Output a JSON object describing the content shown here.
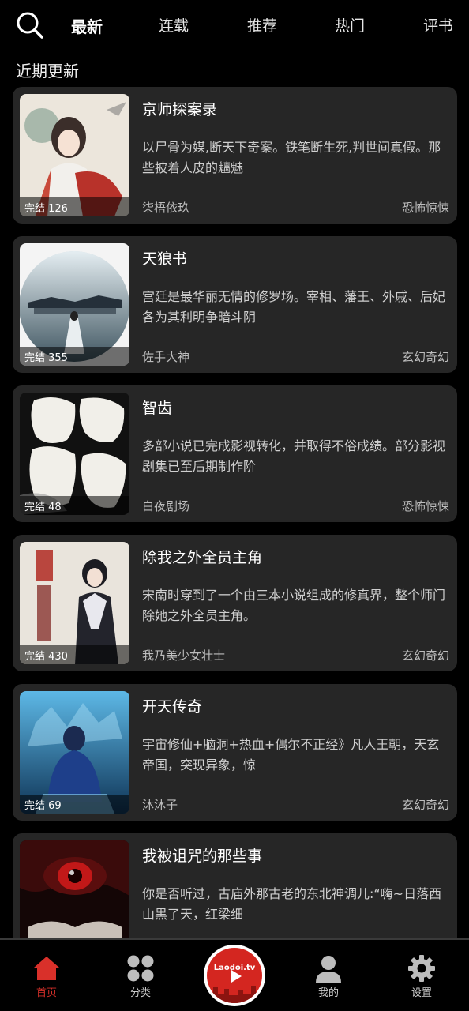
{
  "header": {
    "tabs": [
      {
        "label": "最新",
        "active": true
      },
      {
        "label": "连载",
        "active": false
      },
      {
        "label": "推荐",
        "active": false
      },
      {
        "label": "热门",
        "active": false
      },
      {
        "label": "评书",
        "active": false
      }
    ]
  },
  "section_title": "近期更新",
  "books": [
    {
      "title": "京师探案录",
      "description": "以尸骨为媒,断天下奇案。铁笔断生死,判世间真假。那些披着人皮的魑魅",
      "author": "柒梧依玖",
      "genre": "恐怖惊悚",
      "badge": "完结 126"
    },
    {
      "title": "天狼书",
      "description": "宫廷是最华丽无情的修罗场。宰相、藩王、外戚、后妃各为其利明争暗斗阴",
      "author": "佐手大神",
      "genre": "玄幻奇幻",
      "badge": "完结 355"
    },
    {
      "title": "智齿",
      "description": "多部小说已完成影视转化，并取得不俗成绩。部分影视剧集已至后期制作阶",
      "author": "白夜剧场",
      "genre": "恐怖惊悚",
      "badge": "完结 48"
    },
    {
      "title": "除我之外全员主角",
      "description": "宋南时穿到了一个由三本小说组成的修真界，整个师门除她之外全员主角。",
      "author": "我乃美少女壮士",
      "genre": "玄幻奇幻",
      "badge": "完结 430"
    },
    {
      "title": "开天传奇",
      "description": "宇宙修仙+脑洞+热血+偶尔不正经》凡人王朝，天玄帝国，突现异象，惊",
      "author": "沐沐子",
      "genre": "玄幻奇幻",
      "badge": "完结 69"
    },
    {
      "title": "我被诅咒的那些事",
      "description": "你是否听过，古庙外那古老的东北神调儿:“嗨~日落西山黑了天，红梁细",
      "author": "",
      "genre": "",
      "badge": ""
    }
  ],
  "bottom_nav": {
    "items": [
      {
        "label": "首页",
        "active": true
      },
      {
        "label": "分类",
        "active": false
      },
      {
        "label": "我的",
        "active": false
      },
      {
        "label": "设置",
        "active": false
      }
    ],
    "center_logo": "Laodoi.tv"
  },
  "colors": {
    "accent": "#d9302a",
    "card_bg": "#262626",
    "background": "#000000"
  }
}
